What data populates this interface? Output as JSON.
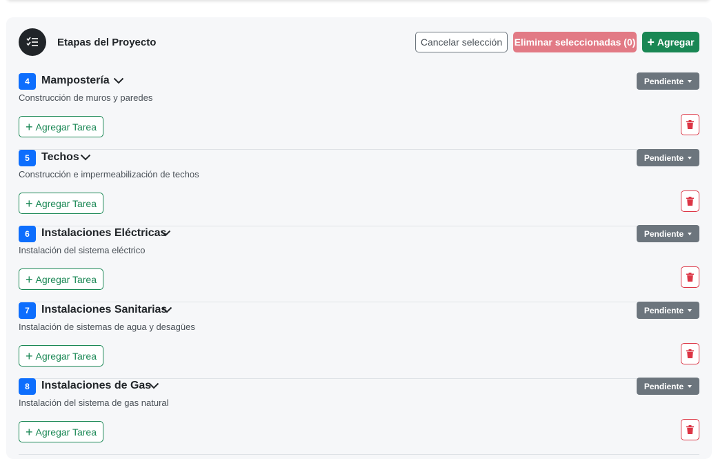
{
  "header": {
    "title": "Etapas del Proyecto",
    "icon": "checklist-icon",
    "cancel_label": "Cancelar selección",
    "delete_label": "Eliminar seleccionadas (0)",
    "add_label": "Agregar"
  },
  "stages": [
    {
      "number": "4",
      "title": "Mampostería",
      "description": "Construcción de muros y paredes",
      "status": "Pendiente",
      "add_task_label": "Agregar Tarea"
    },
    {
      "number": "5",
      "title": "Techos",
      "description": "Construcción e impermeabilización de techos",
      "status": "Pendiente",
      "add_task_label": "Agregar Tarea"
    },
    {
      "number": "6",
      "title": "Instalaciones Eléctricas",
      "description": "Instalación del sistema eléctrico",
      "status": "Pendiente",
      "add_task_label": "Agregar Tarea"
    },
    {
      "number": "7",
      "title": "Instalaciones Sanitarias",
      "description": "Instalación de sistemas de agua y desagües",
      "status": "Pendiente",
      "add_task_label": "Agregar Tarea"
    },
    {
      "number": "8",
      "title": "Instalaciones de Gas",
      "description": "Instalación del sistema de gas natural",
      "status": "Pendiente",
      "add_task_label": "Agregar Tarea"
    }
  ],
  "colors": {
    "primary": "#0d6efd",
    "success": "#198754",
    "danger": "#dc3545",
    "secondary": "#6c757d"
  }
}
